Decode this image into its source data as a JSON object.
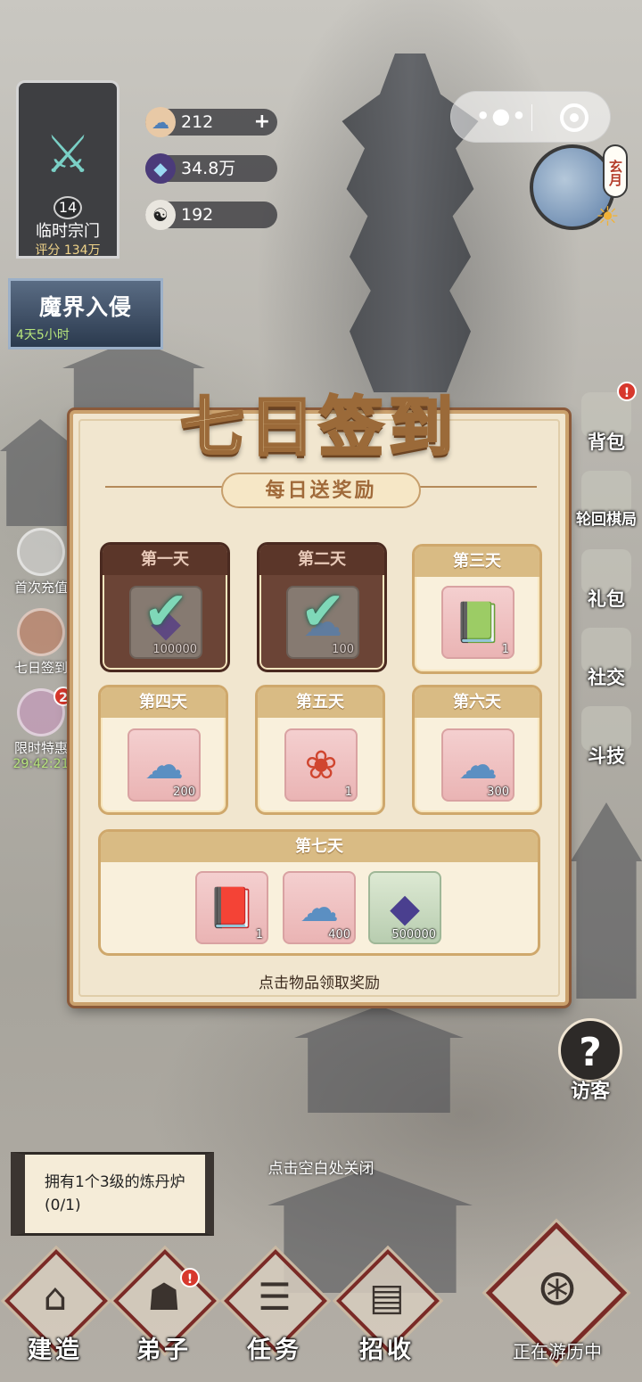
{
  "sect": {
    "level": "14",
    "name": "临时宗门",
    "score": "评分 134万",
    "emblem_icon": "sword-emblem-icon"
  },
  "resources": [
    {
      "icon": "spirit-cloud-icon",
      "value": "212",
      "has_plus": true
    },
    {
      "icon": "spirit-stone-icon",
      "value": "34.8万",
      "has_plus": false
    },
    {
      "icon": "yin-yang-icon",
      "value": "192",
      "has_plus": false
    }
  ],
  "clock": {
    "label": "玄月"
  },
  "event": {
    "title": "魔界入侵",
    "timer": "4天5小时"
  },
  "left_menu": [
    {
      "label": "首次充值",
      "badge": ""
    },
    {
      "label": "七日签到",
      "badge": ""
    },
    {
      "label": "限时特惠",
      "badge": "2",
      "timer": "29:42:21"
    }
  ],
  "right_menu": [
    {
      "label": "背包",
      "badge": "!"
    },
    {
      "label": "轮回棋局",
      "badge": ""
    },
    {
      "label": "礼包",
      "badge": ""
    },
    {
      "label": "社交",
      "badge": ""
    },
    {
      "label": "斗技",
      "badge": ""
    }
  ],
  "dialog": {
    "title": "七日签到",
    "subtitle": "每日送奖励",
    "days": [
      {
        "label": "第一天",
        "claimed": true,
        "items": [
          {
            "icon": "spirit-stone-icon",
            "qty": "100000"
          }
        ]
      },
      {
        "label": "第二天",
        "claimed": true,
        "items": [
          {
            "icon": "spirit-cloud-icon",
            "qty": "100"
          }
        ]
      },
      {
        "label": "第三天",
        "claimed": false,
        "items": [
          {
            "icon": "technique-book-icon",
            "qty": "1"
          }
        ]
      },
      {
        "label": "第四天",
        "claimed": false,
        "items": [
          {
            "icon": "spirit-cloud-icon",
            "qty": "200"
          }
        ]
      },
      {
        "label": "第五天",
        "claimed": false,
        "items": [
          {
            "icon": "red-pouch-icon",
            "qty": "1"
          }
        ]
      },
      {
        "label": "第六天",
        "claimed": false,
        "items": [
          {
            "icon": "spirit-cloud-icon",
            "qty": "300"
          }
        ]
      }
    ],
    "day7": {
      "label": "第七天",
      "items": [
        {
          "icon": "golden-book-icon",
          "qty": "1"
        },
        {
          "icon": "spirit-cloud-icon",
          "qty": "400"
        },
        {
          "icon": "spirit-stone-icon",
          "qty": "500000"
        }
      ]
    },
    "hint": "点击物品领取奖励"
  },
  "close_hint": "点击空白处关闭",
  "quest": {
    "text": "拥有1个3级的炼丹炉(0/1)"
  },
  "visitor": {
    "label": "访客"
  },
  "bottom_nav": [
    {
      "label": "建造",
      "icon": "build-icon",
      "badge": ""
    },
    {
      "label": "弟子",
      "icon": "disciple-icon",
      "badge": "!"
    },
    {
      "label": "任务",
      "icon": "scroll-icon",
      "badge": ""
    },
    {
      "label": "招收",
      "icon": "recruit-card-icon",
      "badge": ""
    }
  ],
  "travel": {
    "label": "正在游历中"
  }
}
